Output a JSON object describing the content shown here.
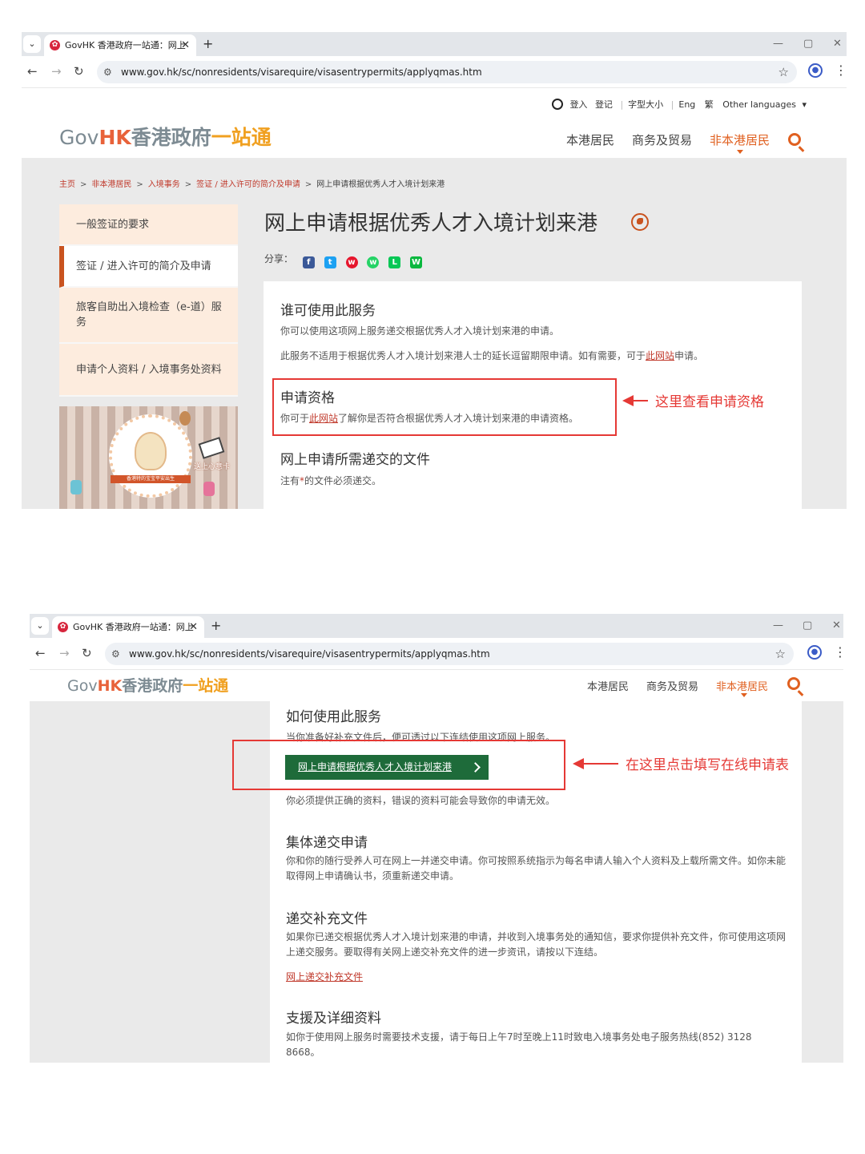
{
  "browser": {
    "tab_title": "GovHK 香港政府一站通：网上",
    "url": "www.gov.hk/sc/nonresidents/visarequire/visasentrypermits/applyqmas.htm",
    "close_glyph": "✕",
    "new_tab_glyph": "+",
    "window_controls": [
      "—",
      "▢",
      "✕"
    ],
    "icons": [
      "back-icon",
      "forward-icon",
      "reload-icon",
      "site-settings-icon",
      "bookmark-star-icon",
      "profile-icon",
      "more-menu-icon"
    ]
  },
  "site": {
    "logo_gov": "Gov",
    "logo_hk": "HK",
    "logo_cn": "香港政府",
    "logo_onestop": "一站通",
    "nav": [
      "本港居民",
      "商务及贸易",
      "非本港居民"
    ],
    "active_nav": "非本港居民",
    "accent_color": "#e06020",
    "utility": {
      "login": "登入",
      "register": "登记",
      "font_size": "字型大小",
      "eng": "Eng",
      "trad": "繁",
      "other_languages": "Other languages"
    }
  },
  "breadcrumb": [
    "主页",
    "非本港居民",
    "入境事务",
    "签证 / 进入许可的简介及申请",
    "网上申请根据优秀人才入境计划来港"
  ],
  "sidebar": [
    "一般签证的要求",
    "签证 / 进入许可的简介及申请",
    "旅客自助出入境检查（e-道）服务",
    "申请个人资料 / 入境事务处资料"
  ],
  "banner": {
    "text": "送上心意卡",
    "ribbon": "香港特的宝宝平安出生"
  },
  "page": {
    "title": "网上申请根据优秀人才入境计划来港",
    "share_label": "分享：",
    "share_icons": [
      "facebook-icon",
      "twitter-icon",
      "weibo-icon",
      "whatsapp-icon",
      "line-icon",
      "wechat-icon"
    ],
    "who": {
      "heading": "谁可使用此服务",
      "p1": "你可以使用这项网上服务递交根据优秀人才入境计划来港的申请。",
      "p2_before": "此服务不适用于根据优秀人才入境计划来港人士的延长逗留期限申请。如有需要，可于",
      "p2_link": "此网站",
      "p2_after": "申请。"
    },
    "eligibility": {
      "heading": "申请资格",
      "p_before": "你可于",
      "p_link": "此网站",
      "p_after": "了解你是否符合根据优秀人才入境计划来港的申请资格。"
    },
    "documents": {
      "heading": "网上申请所需递交的文件",
      "note_before": "注有",
      "note_star": "*",
      "note_after": "的文件必须递交。"
    },
    "how": {
      "heading": "如何使用此服务",
      "p1": "当你准备好补充文件后，便可透过以下连结使用这项网上服务。",
      "button": "网上申请根据优秀人才入境计划来港",
      "p2": "你必须提供正确的资料，错误的资料可能会导致你的申请无效。"
    },
    "group": {
      "heading": "集体递交申请",
      "p": "你和你的随行受养人可在网上一并递交申请。你可按照系统指示为每名申请人输入个人资料及上载所需文件。如你未能取得网上申请确认书，须重新递交申请。"
    },
    "supplement": {
      "heading": "递交补充文件",
      "p": "如果你已递交根据优秀人才入境计划来港的申请，并收到入境事务处的通知信，要求你提供补充文件，你可使用这项网上递交服务。要取得有关网上递交补充文件的进一步资讯，请按以下连结。",
      "link": "网上递交补充文件"
    },
    "support": {
      "heading": "支援及详细资料",
      "p": "如你于使用网上服务时需要技术支援，请于每日上午7时至晚上11时致电入境事务处电子服务热线(852) 3128 8668。"
    }
  },
  "annotations": {
    "eligibility": "这里查看申请资格",
    "apply": "在这里点击填写在线申请表",
    "color": "#e53935"
  }
}
